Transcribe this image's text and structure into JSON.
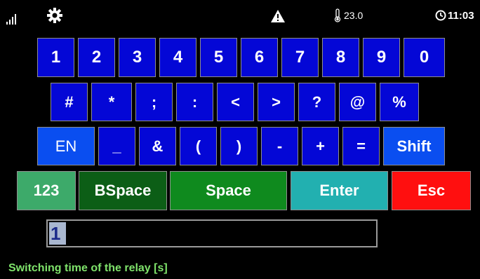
{
  "status_bar": {
    "temperature": "23.0",
    "time": "11:03"
  },
  "keyboard": {
    "row1": [
      "1",
      "2",
      "3",
      "4",
      "5",
      "6",
      "7",
      "8",
      "9",
      "0"
    ],
    "row2": [
      "#",
      "*",
      ";",
      ":",
      "<",
      ">",
      "?",
      "@",
      "%"
    ],
    "row3": [
      "EN",
      "_",
      "&",
      "(",
      ")",
      "-",
      "+",
      "=",
      "Shift"
    ],
    "row4": {
      "num": "123",
      "bspace": "BSpace",
      "space": "Space",
      "enter": "Enter",
      "esc": "Esc"
    }
  },
  "input": {
    "value": "1"
  },
  "hint": {
    "text": "Switching time of the relay [s]"
  },
  "colors": {
    "key_blue": "#0407d6",
    "key_bright_blue": "#0a4ef0",
    "num_key": "#3daa6a",
    "bspace_key": "#0c5e16",
    "space_key": "#0f8a1e",
    "enter_key": "#22b0b0",
    "esc_key": "#ff0f0f",
    "hint_text": "#7fe36b"
  }
}
